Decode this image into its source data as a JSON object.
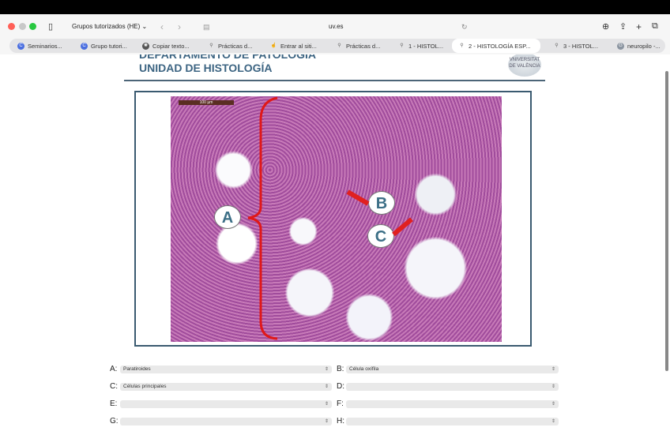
{
  "browser": {
    "tab_group": "Grupos tutorizados (HE)",
    "url": "uv.es",
    "tabs": [
      {
        "label": "Seminarios...",
        "icon": "c-icon"
      },
      {
        "label": "Grupo tutori...",
        "icon": "c-icon"
      },
      {
        "label": "Copiar texto...",
        "icon": "ai-icon"
      },
      {
        "label": "Prácticas d...",
        "icon": "microscope-icon"
      },
      {
        "label": "Entrar al siti...",
        "icon": "hand-icon"
      },
      {
        "label": "Prácticas d...",
        "icon": "microscope-icon"
      },
      {
        "label": "1 - HISTOL...",
        "icon": "microscope-icon"
      },
      {
        "label": "2 - HISTOLOGÍA ESP...",
        "icon": "microscope-icon",
        "active": true
      },
      {
        "label": "3 - HISTOL...",
        "icon": "microscope-icon"
      },
      {
        "label": "neuropilo -...",
        "icon": "g-icon"
      }
    ]
  },
  "header": {
    "department": "DEPARTAMENTO DE PATOLOGÍA",
    "unit": "UNIDAD DE HISTOLOGÍA",
    "logo_text": "VNIVERSITAT DE VALÈNCIA"
  },
  "image": {
    "scale_bar": "100 µm",
    "labels": [
      "A",
      "B",
      "C"
    ]
  },
  "form": {
    "rows": [
      {
        "label": "A:",
        "value": "Paratiroides"
      },
      {
        "label": "B:",
        "value": "Célula oxífila"
      },
      {
        "label": "C:",
        "value": "Células principales"
      },
      {
        "label": "D:",
        "value": ""
      },
      {
        "label": "E:",
        "value": ""
      },
      {
        "label": "F:",
        "value": ""
      },
      {
        "label": "G:",
        "value": ""
      },
      {
        "label": "H:",
        "value": ""
      }
    ]
  },
  "colors": {
    "accent": "#3c6482",
    "arrow": "#e02020"
  }
}
